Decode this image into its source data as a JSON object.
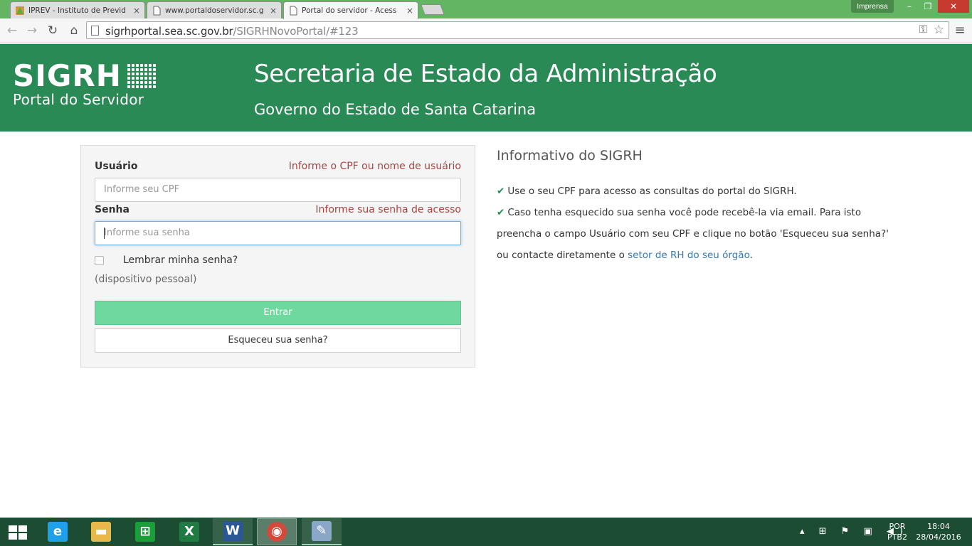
{
  "browser": {
    "tabs": [
      {
        "label": "IPREV - Instituto de Previd",
        "close": "×",
        "active": false
      },
      {
        "label": "www.portaldoservidor.sc.g",
        "close": "×",
        "active": false
      },
      {
        "label": "Portal do servidor - Acess",
        "close": "×",
        "active": true
      }
    ],
    "incognito_label": "Imprensa",
    "window_controls": {
      "minimize": "–",
      "maximize": "❐",
      "close": "✕"
    },
    "nav": {
      "back": "←",
      "forward": "→",
      "reload": "↻",
      "home": "⌂"
    },
    "address": {
      "host": "sigrhportal.sea.sc.gov.br",
      "path": "/SIGRHNovoPortal/#123"
    },
    "menu": "≡",
    "star": "☆",
    "key": "⚿"
  },
  "header": {
    "logo_text": "SIGRH",
    "logo_subtitle": "Portal do Servidor",
    "title": "Secretaria de Estado da Administração",
    "subtitle": "Governo do Estado de Santa Catarina",
    "background": "#2a8a55"
  },
  "login": {
    "user_label": "Usuário",
    "user_hint": "Informe o CPF ou nome de usuário",
    "user_placeholder": "Informe seu CPF",
    "password_label": "Senha",
    "password_hint": "Informe sua senha de acesso",
    "password_placeholder": "Informe sua senha",
    "remember_label": "Lembrar minha senha?",
    "remember_checked": false,
    "device_note": "(dispositivo pessoal)",
    "submit_label": "Entrar",
    "forgot_label": "Esqueceu sua senha?",
    "hint_color": "#a94442",
    "submit_color": "#6fd89f"
  },
  "info": {
    "title": "Informativo do SIGRH",
    "item1": "Use o seu CPF para acesso as consultas do portal do SIGRH.",
    "item2_line1": "Caso tenha esquecido sua senha você pode recebê-la via email. Para isto",
    "item2_line2": "preencha o campo Usuário com seu CPF e clique no botão 'Esqueceu sua senha?'",
    "item2_line3_prefix": "ou contacte diretamente o ",
    "item2_link": "setor de RH do seu órgão",
    "item2_line3_suffix": ".",
    "check_icon": "✔"
  },
  "taskbar": {
    "apps": [
      {
        "name": "internet-explorer-icon",
        "glyph": "e",
        "color": "#1ea1e8"
      },
      {
        "name": "file-explorer-icon",
        "glyph": "▬",
        "color": "#e8b84a"
      },
      {
        "name": "store-icon",
        "glyph": "⊞",
        "color": "#1a9e3a"
      },
      {
        "name": "excel-icon",
        "glyph": "X",
        "color": "#1f7a44"
      },
      {
        "name": "word-icon",
        "glyph": "W",
        "color": "#2b5797"
      },
      {
        "name": "chrome-icon",
        "glyph": "◉",
        "color": "#d44a3a"
      },
      {
        "name": "paint-icon",
        "glyph": "✎",
        "color": "#8aa7c8"
      }
    ],
    "language_top": "POR",
    "language_bottom": "PTB2",
    "time": "18:04",
    "date": "28/04/2016"
  }
}
